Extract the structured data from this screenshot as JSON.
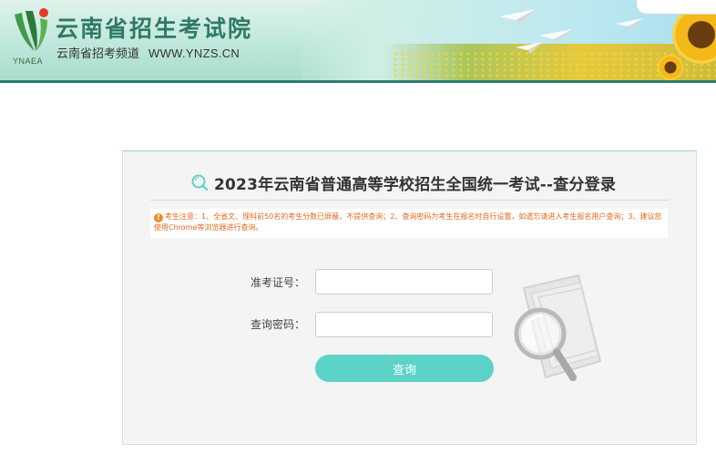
{
  "header": {
    "logo_caption": "YNAEA",
    "title": "云南省招生考试院",
    "subtitle": "云南省招考频道",
    "url": "WWW.YNZS.CN"
  },
  "login": {
    "title": "2023年云南省普通高等学校招生全国统一考试--查分登录",
    "notice": "考生注意：1、全省文、理科前50名的考生分数已屏蔽，不提供查询；2、查询密码为考生在报名时自行设置，如遗忘请进入考生报名用户查询；3、建议您使用Chrome等浏览器进行查询。",
    "exam_id_label": "准考证号：",
    "exam_id_value": "",
    "password_label": "查询密码：",
    "password_value": "",
    "submit_label": "查询"
  },
  "icons": {
    "title_icon": "search-icon",
    "notice_icon": "warning-icon",
    "decoration": "magnifier-folder-icon"
  },
  "colors": {
    "accent": "#5cd3c6",
    "brand": "#2f7a66",
    "notice_text": "#e36a1e",
    "header_line": "#2a7f73"
  }
}
